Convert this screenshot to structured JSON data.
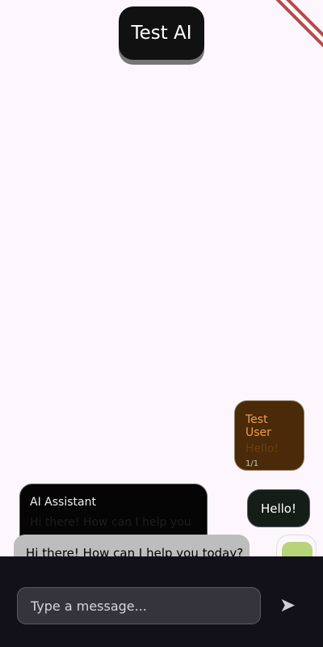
{
  "app": {
    "title": "Test AI"
  },
  "messages": {
    "user_card": {
      "name": "Test User",
      "text": "Hello!",
      "count": "1/1"
    },
    "assistant_card": {
      "name": "AI Assistant",
      "text": "Hi there! How can I help you"
    },
    "hello_bubble": {
      "text": "Hello!"
    },
    "reply_bubble": {
      "text": "Hi there! How can I help you today?"
    }
  },
  "composer": {
    "placeholder": "Type a message...",
    "send_icon": "send-icon"
  },
  "colors": {
    "background": "#fdf7fd",
    "title_bg": "#111111",
    "user_accent": "#f39d4f",
    "composer_bg": "#121018"
  }
}
